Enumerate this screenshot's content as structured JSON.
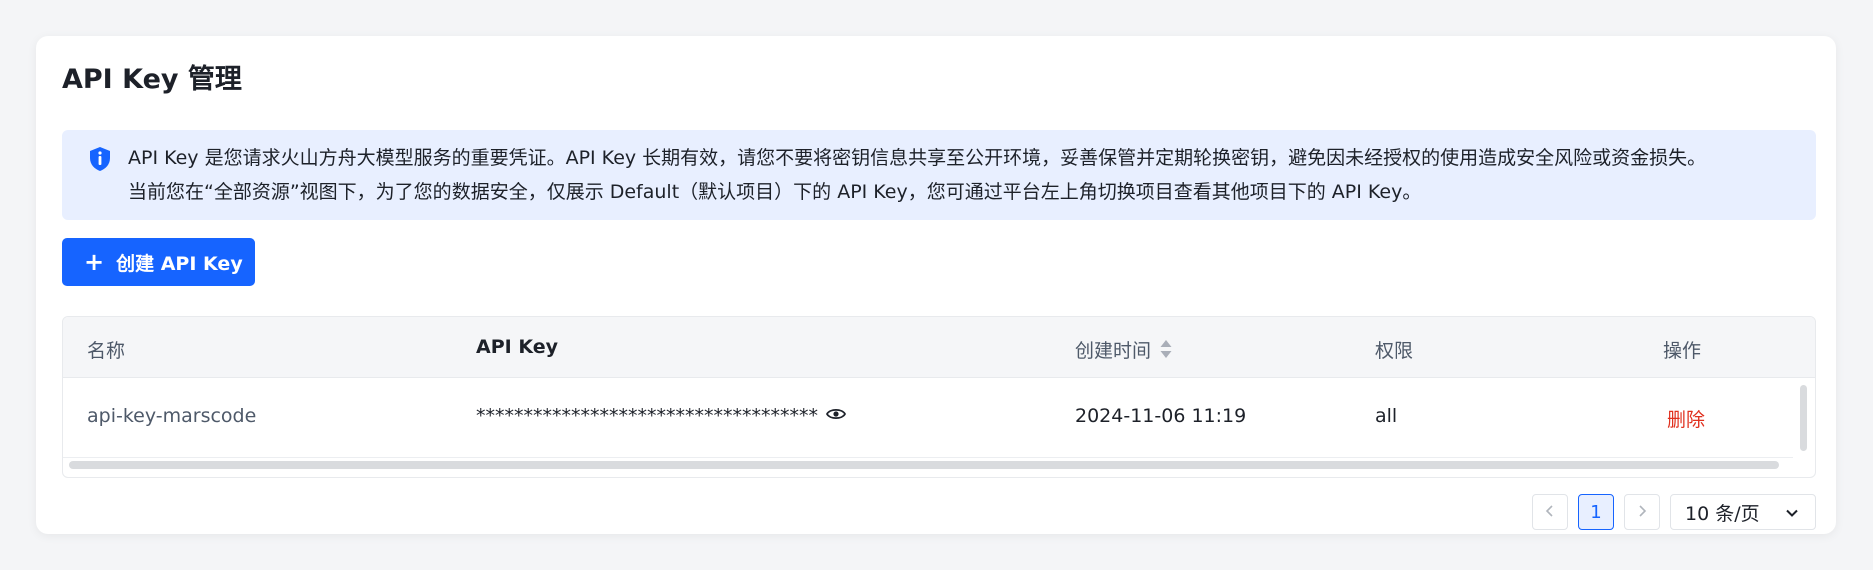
{
  "header": {
    "title": "API Key 管理"
  },
  "alert": {
    "icon": "shield-info-icon",
    "line1": "API Key 是您请求火山方舟大模型服务的重要凭证。API Key 长期有效，请您不要将密钥信息共享至公开环境，妥善保管并定期轮换密钥，避免因未经授权的使用造成安全风险或资金损失。",
    "line2": "当前您在“全部资源”视图下，为了您的数据安全，仅展示 Default（默认项目）下的 API Key，您可通过平台左上角切换项目查看其他项目下的 API Key。"
  },
  "toolbar": {
    "create_label": "创建 API Key",
    "create_icon": "plus-icon"
  },
  "table": {
    "columns": [
      "名称",
      "API Key",
      "创建时间",
      "权限",
      "操作"
    ],
    "rows": [
      {
        "name": "api-key-marscode",
        "key": "************************************",
        "created": "2024-11-06 11:19",
        "permission": "all",
        "action": "删除"
      }
    ]
  },
  "pagination": {
    "current_page": "1",
    "page_size": "10 条/页",
    "prev_icon": "chevron-left-icon",
    "next_icon": "chevron-right-icon"
  },
  "colors": {
    "primary": "#1664ff",
    "alert_bg": "#e8efff",
    "danger": "#e0301e"
  }
}
